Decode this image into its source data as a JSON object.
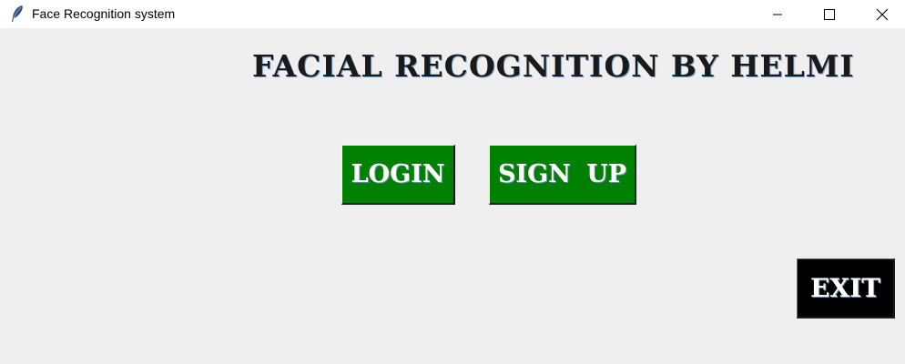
{
  "window": {
    "title": "Face Recognition system",
    "app_icon": "feather-icon",
    "controls": {
      "minimize_icon": "minimize-icon",
      "maximize_icon": "maximize-icon",
      "close_icon": "close-icon"
    }
  },
  "main": {
    "heading": "FACIAL RECOGNITION BY HELMI",
    "login_label": "LOGIN",
    "signup_label": "SIGN UP",
    "exit_label": "EXIT"
  },
  "colors": {
    "background": "#f0f0f0",
    "login_button": "#008000",
    "signup_button": "#008000",
    "exit_button": "#000000",
    "button_text": "#ffffff"
  }
}
